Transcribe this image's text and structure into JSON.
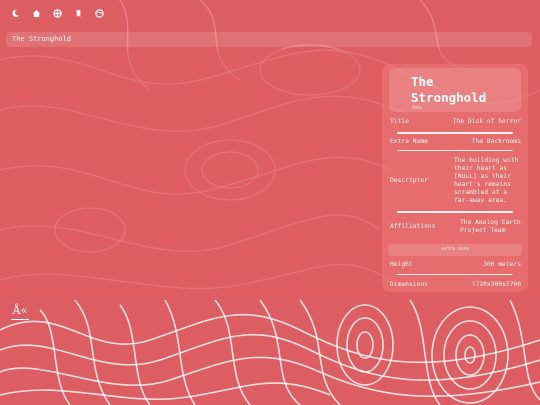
{
  "toolbar": {
    "icons": [
      "moon-icon",
      "home-icon",
      "grid-icon",
      "bookmark-icon",
      "globe-icon"
    ]
  },
  "page": {
    "breadcrumb": "The Stronghold"
  },
  "infobox": {
    "title": "The Stronghold",
    "subtitle": "Info",
    "extra_info_label": "extra info",
    "rows": [
      {
        "label": "Title",
        "value": "The Disk of horror"
      },
      {
        "label": "Extra Name",
        "value": "The Backrooms"
      },
      {
        "label": "Descriptor",
        "value": "The building with their heart as [NULL] as their heart's remains scrambled at a far-away area."
      },
      {
        "label": "Affiliations",
        "value": "The Analog Earth Project Team"
      }
    ],
    "extra_rows": [
      {
        "label": "Height",
        "value": "300 meters"
      },
      {
        "label": "Dimensions",
        "value": "1720x300x1700"
      }
    ]
  },
  "footer": {
    "logo_text": "Å«"
  },
  "colors": {
    "background": "#dc5d62",
    "contour_lines": "#ffffff",
    "panel": "#ec7878"
  }
}
